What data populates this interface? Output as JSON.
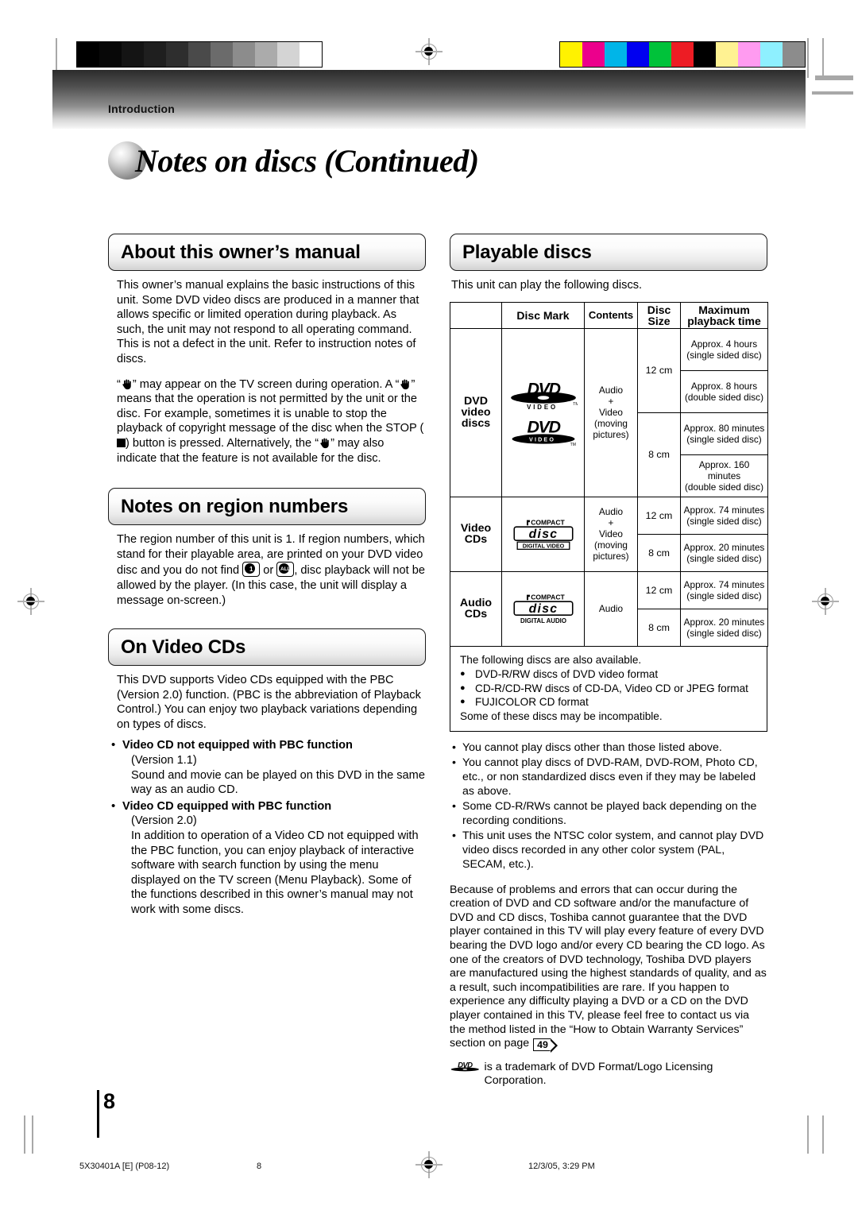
{
  "banner": {
    "label": "Introduction"
  },
  "title": "Notes on discs (Continued)",
  "calibration": {
    "grayscale": [
      "#000000",
      "#080808",
      "#141414",
      "#1f1f1f",
      "#2e2e2e",
      "#4a4a4a",
      "#6b6b6b",
      "#8c8c8c",
      "#ababab",
      "#d4d4d4",
      "#ffffff"
    ],
    "colors": [
      "#fff200",
      "#ec008c",
      "#00b5e8",
      "#0000f0",
      "#00c23a",
      "#ed1c24",
      "#000000",
      "#fff292",
      "#ff9bf0",
      "#8ef0ff",
      "#8c8c8c"
    ]
  },
  "left_column": {
    "about": {
      "heading": "About this owner’s manual",
      "paragraph1": "This owner’s manual explains the basic instructions of this unit. Some DVD video discs are produced in a manner that allows specific or limited operation during playback. As such, the unit may not respond to all operating command. This is not a defect in the unit. Refer to instruction notes of discs.",
      "p2_a": "“",
      "p2_b": "” may appear on the TV screen during operation. A “",
      "p2_c": "” means that the operation is not permitted by the unit or the disc.",
      "p2_d": "For example, sometimes it is unable to stop the playback of copyright message of the disc when the STOP (",
      "p2_e": ") button is pressed. Alternatively, the “",
      "p2_f": "” may also indicate that the feature is not available for the disc."
    },
    "region": {
      "heading": "Notes on region numbers",
      "text_a": "The region number of this unit is 1. If region numbers, which stand for their playable area, are printed on your DVD video disc and you do not find",
      "icon1_label": "1",
      "text_b": "or",
      "icon2_label": "ALL",
      "text_c": ", disc playback will not be allowed by the player. (In this case, the unit will display a message on-screen.)"
    },
    "videocd": {
      "heading": "On Video CDs",
      "paragraph": "This DVD supports Video CDs equipped with the PBC (Version 2.0) function. (PBC is the abbreviation of Playback Control.) You can enjoy two playback variations depending on types of discs.",
      "items": [
        {
          "title": "Video CD not equipped with PBC function",
          "version": "(Version 1.1)",
          "body": "Sound and movie can be played on this DVD in the same way as an audio CD."
        },
        {
          "title": "Video CD equipped with PBC function",
          "version": "(Version 2.0)",
          "body": "In addition to operation of a Video CD not equipped with the PBC function, you can enjoy playback of interactive software with search function by using the menu displayed on the TV screen (Menu Playback). Some of the functions described in this owner’s manual may not work with some discs."
        }
      ]
    }
  },
  "right_column": {
    "playable": {
      "heading": "Playable discs",
      "intro": "This unit can play the following discs."
    },
    "table": {
      "headers": [
        "",
        "Disc Mark",
        "Contents",
        "Disc Size",
        "Maximum playback time"
      ],
      "rows": [
        {
          "name": "DVD video discs",
          "marks": [
            "dvd-video-logo",
            "dvd-video-logo-alt"
          ],
          "contents": "Audio + Video (moving pictures)",
          "contents_lines": [
            "Audio",
            "+",
            "Video",
            "(moving",
            "pictures)"
          ],
          "sizes": [
            {
              "size": "12 cm",
              "times": [
                "Approx. 4 hours (single sided disc)",
                "Approx. 8 hours (double sided disc)"
              ]
            },
            {
              "size": "8 cm",
              "times": [
                "Approx. 80 minutes (single sided disc)",
                "Approx. 160 minutes (double sided disc)"
              ]
            }
          ]
        },
        {
          "name": "Video CDs",
          "marks": [
            "compact-disc-digital-video-logo"
          ],
          "mark_top": "COMPACT",
          "mark_bottom": "DIGITAL VIDEO",
          "contents_lines": [
            "Audio",
            "+",
            "Video",
            "(moving",
            "pictures)"
          ],
          "sizes": [
            {
              "size": "12 cm",
              "times": [
                "Approx. 74 minutes (single sided disc)"
              ]
            },
            {
              "size": "8 cm",
              "times": [
                "Approx. 20 minutes (single sided disc)"
              ]
            }
          ]
        },
        {
          "name": "Audio CDs",
          "marks": [
            "compact-disc-digital-audio-logo"
          ],
          "mark_top": "COMPACT",
          "mark_bottom": "DIGITAL AUDIO",
          "contents_lines": [
            "Audio"
          ],
          "sizes": [
            {
              "size": "12 cm",
              "times": [
                "Approx. 74 minutes (single sided disc)"
              ]
            },
            {
              "size": "8 cm",
              "times": [
                "Approx. 20 minutes (single sided disc)"
              ]
            }
          ]
        }
      ],
      "time_cells": {
        "dvd_12_single": "Approx. 4 hours",
        "dvd_12_single_sub": "(single sided disc)",
        "dvd_12_double": "Approx. 8 hours",
        "dvd_12_double_sub": "(double sided disc)",
        "dvd_8_single": "Approx. 80 minutes",
        "dvd_8_single_sub": "(single sided disc)",
        "dvd_8_double": "Approx. 160 minutes",
        "dvd_8_double_sub": "(double sided disc)",
        "vcd_12": "Approx. 74 minutes",
        "vcd_12_sub": "(single sided disc)",
        "vcd_8": "Approx. 20 minutes",
        "vcd_8_sub": "(single sided disc)",
        "acd_12": "Approx. 74 minutes",
        "acd_12_sub": "(single sided disc)",
        "acd_8": "Approx. 20 minutes",
        "acd_8_sub": "(single sided disc)"
      }
    },
    "available_box": {
      "lead": "The following discs are also available.",
      "items": [
        "DVD-R/RW discs of DVD video format",
        "CD-R/CD-RW discs of CD-DA, Video CD or JPEG format",
        "FUJICOLOR CD format"
      ],
      "tail": "Some of these discs may be incompatible."
    },
    "notes": [
      "You cannot play discs other than those listed above.",
      "You cannot play discs of DVD-RAM, DVD-ROM, Photo CD, etc., or non standardized discs even if they may be labeled as above.",
      "Some CD-R/RWs cannot be played back depending on the recording conditions.",
      "This unit uses the NTSC color system, and cannot play DVD video discs recorded in any other color system (PAL, SECAM, etc.)."
    ],
    "disclaimer_a": "Because of problems and errors that can occur during the creation of DVD and CD software and/or the manufacture of DVD and CD discs, Toshiba cannot guarantee that the DVD player contained in this TV will play every feature of every DVD bearing the DVD logo and/or every CD bearing the CD logo.  As one of the creators of DVD technology, Toshiba DVD players are manufactured using the highest standards of quality, and as a result, such incompatibilities are rare. If you happen to experience any difficulty playing a DVD or a CD on the DVD player contained in this TV, please feel free to contact us via the method listed in the “How to Obtain Warranty Services” section on page",
    "disclaimer_page_ref": "49",
    "disclaimer_b": ".",
    "trademark": "is a trademark of DVD Format/Logo Licensing Corporation."
  },
  "page_number": "8",
  "footer": {
    "left": "5X30401A [E] (P08-12)",
    "middle": "8",
    "right": "12/3/05, 3:29 PM"
  }
}
